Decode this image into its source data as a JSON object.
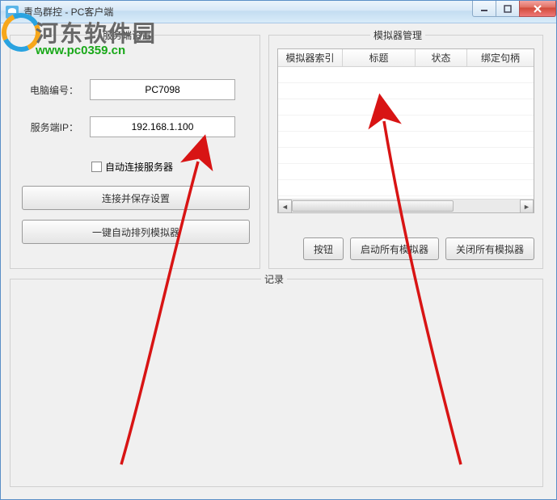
{
  "window": {
    "title": "青鸟群控 - PC客户端"
  },
  "watermark": {
    "text": "河东软件园",
    "url": "www.pc0359.cn"
  },
  "left_panel": {
    "title": "服务端设置",
    "pc_id_label": "电脑编号：",
    "pc_id_value": "PC7098",
    "server_ip_label": "服务端IP：",
    "server_ip_value": "192.168.1.100",
    "auto_connect_label": "自动连接服务器",
    "connect_button": "连接并保存设置",
    "arrange_button": "一键自动排列模拟器"
  },
  "right_panel": {
    "title": "模拟器管理",
    "columns": {
      "c1": "模拟器索引",
      "c2": "标题",
      "c3": "状态",
      "c4": "绑定句柄"
    },
    "btn_generic": "按钮",
    "btn_start_all": "启动所有模拟器",
    "btn_close_all": "关闭所有模拟器"
  },
  "log_panel": {
    "title": "记录"
  }
}
